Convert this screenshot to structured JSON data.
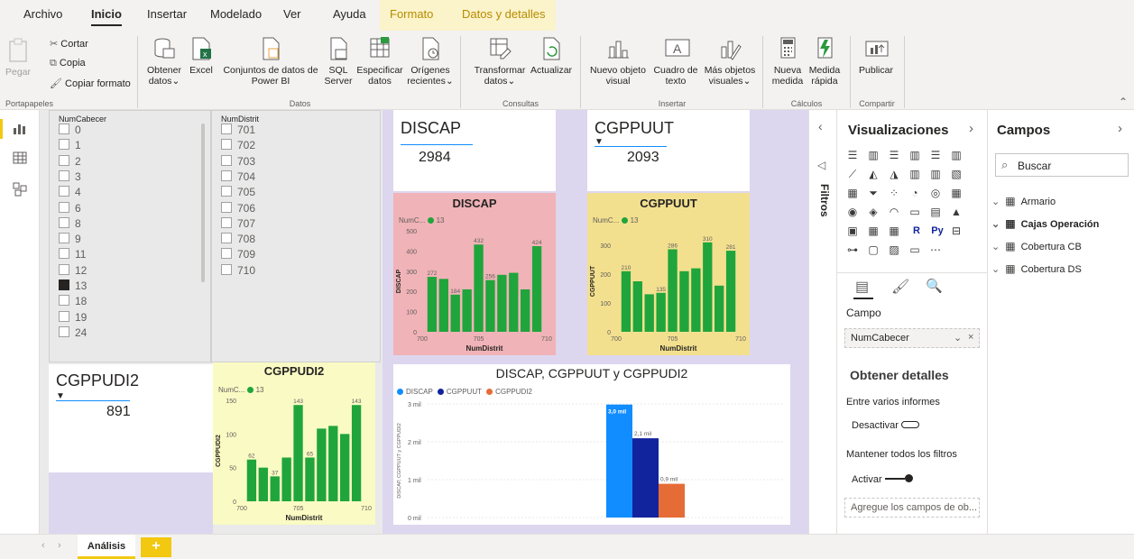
{
  "menu": {
    "tabs": [
      "Archivo",
      "Inicio",
      "Insertar",
      "Modelado",
      "Ver",
      "Ayuda"
    ],
    "context_tabs": [
      "Formato",
      "Datos y detalles"
    ]
  },
  "ribbon": {
    "clipboard": {
      "paste": "Pegar",
      "cut": "Cortar",
      "copy": "Copia",
      "format_painter": "Copiar formato",
      "group": "Portapapeles"
    },
    "data": {
      "get_data": "Obtener",
      "get_data2": "datos",
      "excel": "Excel",
      "pbi": "Conjuntos de datos de",
      "pbi2": "Power BI",
      "sql": "SQL",
      "sql2": "Server",
      "enter": "Especificar",
      "enter2": "datos",
      "recent": "Orígenes",
      "recent2": "recientes",
      "group": "Datos"
    },
    "queries": {
      "transform": "Transformar",
      "transform2": "datos",
      "refresh": "Actualizar",
      "group": "Consultas"
    },
    "insert": {
      "new_visual": "Nuevo objeto",
      "new_visual2": "visual",
      "textbox": "Cuadro de",
      "textbox2": "texto",
      "more": "Más objetos",
      "more2": "visuales",
      "group": "Insertar"
    },
    "calc": {
      "measure": "Nueva",
      "measure2": "medida",
      "quick": "Medida",
      "quick2": "rápida",
      "group": "Cálculos"
    },
    "share": {
      "publish": "Publicar",
      "group": "Compartir"
    }
  },
  "slicers": {
    "numcab": {
      "header": "NumCabecer",
      "items": [
        "0",
        "1",
        "2",
        "3",
        "4",
        "6",
        "8",
        "9",
        "11",
        "12",
        "13",
        "18",
        "19",
        "24"
      ],
      "checked": "13"
    },
    "numdist": {
      "header": "NumDistrit",
      "items": [
        "701",
        "702",
        "703",
        "704",
        "705",
        "706",
        "707",
        "708",
        "709",
        "710"
      ]
    }
  },
  "cards": {
    "discap": {
      "title": "DISCAP",
      "value": "2984"
    },
    "cgppuut": {
      "title": "CGPPUUT",
      "value": "2093"
    },
    "cgppudi2": {
      "title": "CGPPUDI2",
      "value": "891"
    }
  },
  "minicharts": {
    "legend_label": "NumC...",
    "legend_value": "13",
    "xlabel": "NumDistrit",
    "xticks": [
      "700",
      "705",
      "710"
    ]
  },
  "colors": {
    "green": "#1fa53b",
    "discap_bg": "#f0b3b7",
    "cgppuut_bg": "#f3e08f",
    "cgppudi2_bg": "#fafac4",
    "canvas_purple": "#ddd6ef",
    "blue_light": "#118dff",
    "blue_dark": "#12239e",
    "orange": "#e66c37"
  },
  "chart_data": [
    {
      "type": "bar",
      "title": "DISCAP",
      "xlabel": "NumDistrit",
      "ylabel": "DISCAP",
      "x": [
        701,
        702,
        703,
        704,
        705,
        706,
        707,
        708,
        709,
        710
      ],
      "values": [
        272,
        262,
        184,
        210,
        432,
        256,
        282,
        292,
        210,
        424
      ],
      "ylim": [
        0,
        500
      ],
      "yticks": [
        "0",
        "100",
        "200",
        "300",
        "400",
        "500"
      ],
      "labels": {
        "0": "272",
        "2": "184",
        "4": "432",
        "5": "256",
        "9": "424"
      }
    },
    {
      "type": "bar",
      "title": "CGPPUUT",
      "xlabel": "NumDistrit",
      "ylabel": "CGPPUUT",
      "x": [
        701,
        702,
        703,
        704,
        705,
        706,
        707,
        708,
        709,
        710
      ],
      "values": [
        210,
        175,
        130,
        135,
        286,
        210,
        220,
        310,
        160,
        281
      ],
      "ylim": [
        0,
        350
      ],
      "yticks": [
        "0",
        "100",
        "200",
        "300"
      ],
      "labels": {
        "0": "210",
        "3": "135",
        "4": "286",
        "7": "310",
        "9": "281"
      }
    },
    {
      "type": "bar",
      "title": "CGPPUDI2",
      "xlabel": "NumDistrit",
      "ylabel": "CGPPUDI2",
      "x": [
        701,
        702,
        703,
        704,
        705,
        706,
        707,
        708,
        709,
        710
      ],
      "values": [
        62,
        50,
        37,
        65,
        143,
        65,
        108,
        112,
        100,
        143
      ],
      "ylim": [
        0,
        150
      ],
      "yticks": [
        "0",
        "50",
        "100",
        "150"
      ],
      "labels": {
        "0": "62",
        "2": "37",
        "4": "143",
        "5": "65",
        "9": "143"
      }
    },
    {
      "type": "bar",
      "title": "DISCAP, CGPPUUT y CGPPUDI2",
      "ylabel": "DISCAP, CGPPUUT y CGPPUDI2",
      "series": [
        {
          "name": "DISCAP",
          "values": [
            2984
          ],
          "label": "3,0 mil"
        },
        {
          "name": "CGPPUUT",
          "values": [
            2093
          ],
          "label": "2,1 mil"
        },
        {
          "name": "CGPPUDI2",
          "values": [
            891
          ],
          "label": "0,9 mil"
        }
      ],
      "ylim": [
        0,
        3000
      ],
      "yticks": [
        "0 mil",
        "1 mil",
        "2 mil",
        "3 mil"
      ]
    }
  ],
  "viz_pane": {
    "title": "Visualizaciones",
    "campo_label": "Campo",
    "campo_value": "NumCabecer",
    "details_title": "Obtener detalles",
    "cross_report": "Entre varios informes",
    "cross_toggle": "Desactivar",
    "keep_filters": "Mantener todos los filtros",
    "keep_toggle": "Activar",
    "drop_hint": "Agregue los campos de ob..."
  },
  "filters_pane": {
    "label": "Filtros"
  },
  "fields_pane": {
    "title": "Campos",
    "search_placeholder": "Buscar",
    "tables": [
      "Armario",
      "Cajas Operación",
      "Cobertura CB",
      "Cobertura DS"
    ]
  },
  "pages": {
    "tab": "Análisis",
    "add": "+"
  }
}
